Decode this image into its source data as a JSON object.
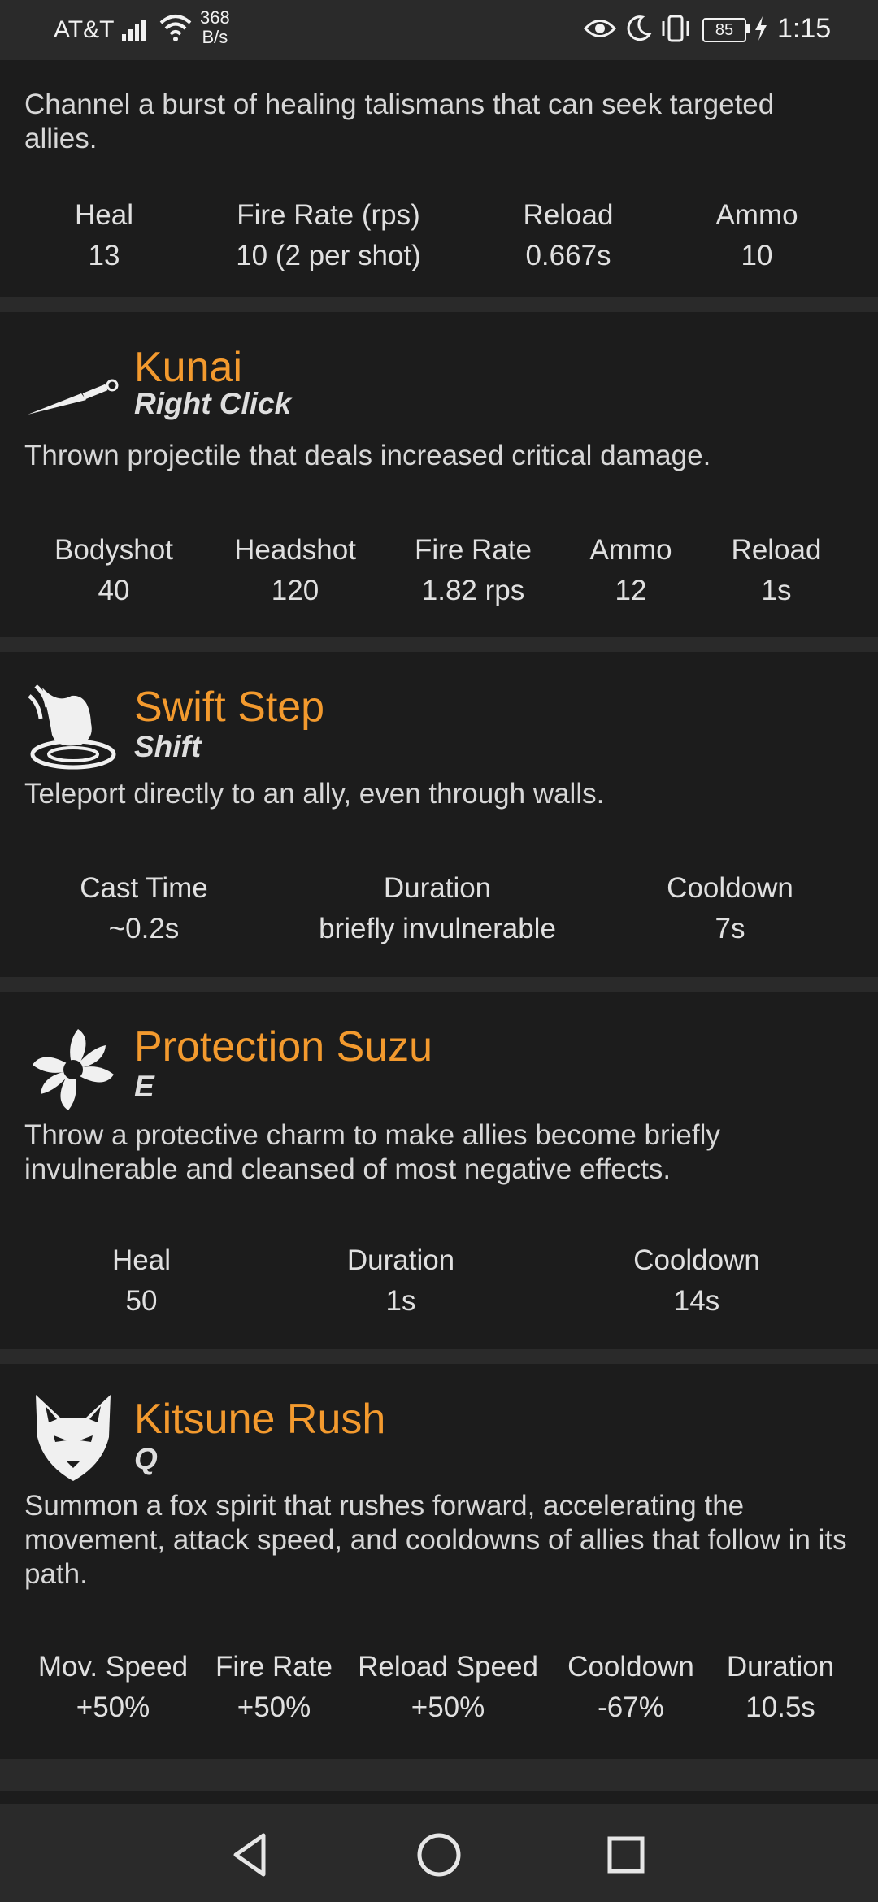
{
  "status_bar": {
    "carrier": "AT&T",
    "net_speed_value": "368",
    "net_speed_unit": "B/s",
    "battery": "85",
    "time": "1:15"
  },
  "abilities": [
    {
      "description": "Channel a burst of healing talismans that can seek targeted allies.",
      "stats": [
        {
          "label": "Heal",
          "value": "13"
        },
        {
          "label": "Fire Rate (rps)",
          "value": "10 (2 per shot)"
        },
        {
          "label": "Reload",
          "value": "0.667s"
        },
        {
          "label": "Ammo",
          "value": "10"
        }
      ]
    },
    {
      "name": "Kunai",
      "key": "Right Click",
      "icon": "kunai-icon",
      "description": "Thrown projectile that deals increased critical damage.",
      "stats": [
        {
          "label": "Bodyshot",
          "value": "40"
        },
        {
          "label": "Headshot",
          "value": "120"
        },
        {
          "label": "Fire Rate",
          "value": "1.82 rps"
        },
        {
          "label": "Ammo",
          "value": "12"
        },
        {
          "label": "Reload",
          "value": "1s"
        }
      ]
    },
    {
      "name": "Swift Step",
      "key": "Shift",
      "icon": "swift-step-icon",
      "description": "Teleport directly to an ally, even through walls.",
      "stats": [
        {
          "label": "Cast Time",
          "value": "~0.2s"
        },
        {
          "label": "Duration",
          "value": "briefly invulnerable"
        },
        {
          "label": "Cooldown",
          "value": "7s"
        }
      ]
    },
    {
      "name": "Protection Suzu",
      "key": "E",
      "icon": "protection-suzu-icon",
      "description": "Throw a protective charm to make allies become briefly invulnerable and cleansed of most negative effects.",
      "stats": [
        {
          "label": "Heal",
          "value": "50"
        },
        {
          "label": "Duration",
          "value": "1s"
        },
        {
          "label": "Cooldown",
          "value": "14s"
        }
      ]
    },
    {
      "name": "Kitsune Rush",
      "key": "Q",
      "icon": "fox-icon",
      "description": "Summon a fox spirit that rushes forward, accelerating the movement, attack speed, and cooldowns of allies that follow in its path.",
      "stats": [
        {
          "label": "Mov. Speed",
          "value": "+50%"
        },
        {
          "label": "Fire Rate",
          "value": "+50%"
        },
        {
          "label": "Reload Speed",
          "value": "+50%"
        },
        {
          "label": "Cooldown",
          "value": "-67%"
        },
        {
          "label": "Duration",
          "value": "10.5s"
        }
      ]
    }
  ],
  "colors": {
    "accent": "#f39a2e",
    "card_bg": "#1c1c1c",
    "page_bg": "#2a2a2a"
  }
}
